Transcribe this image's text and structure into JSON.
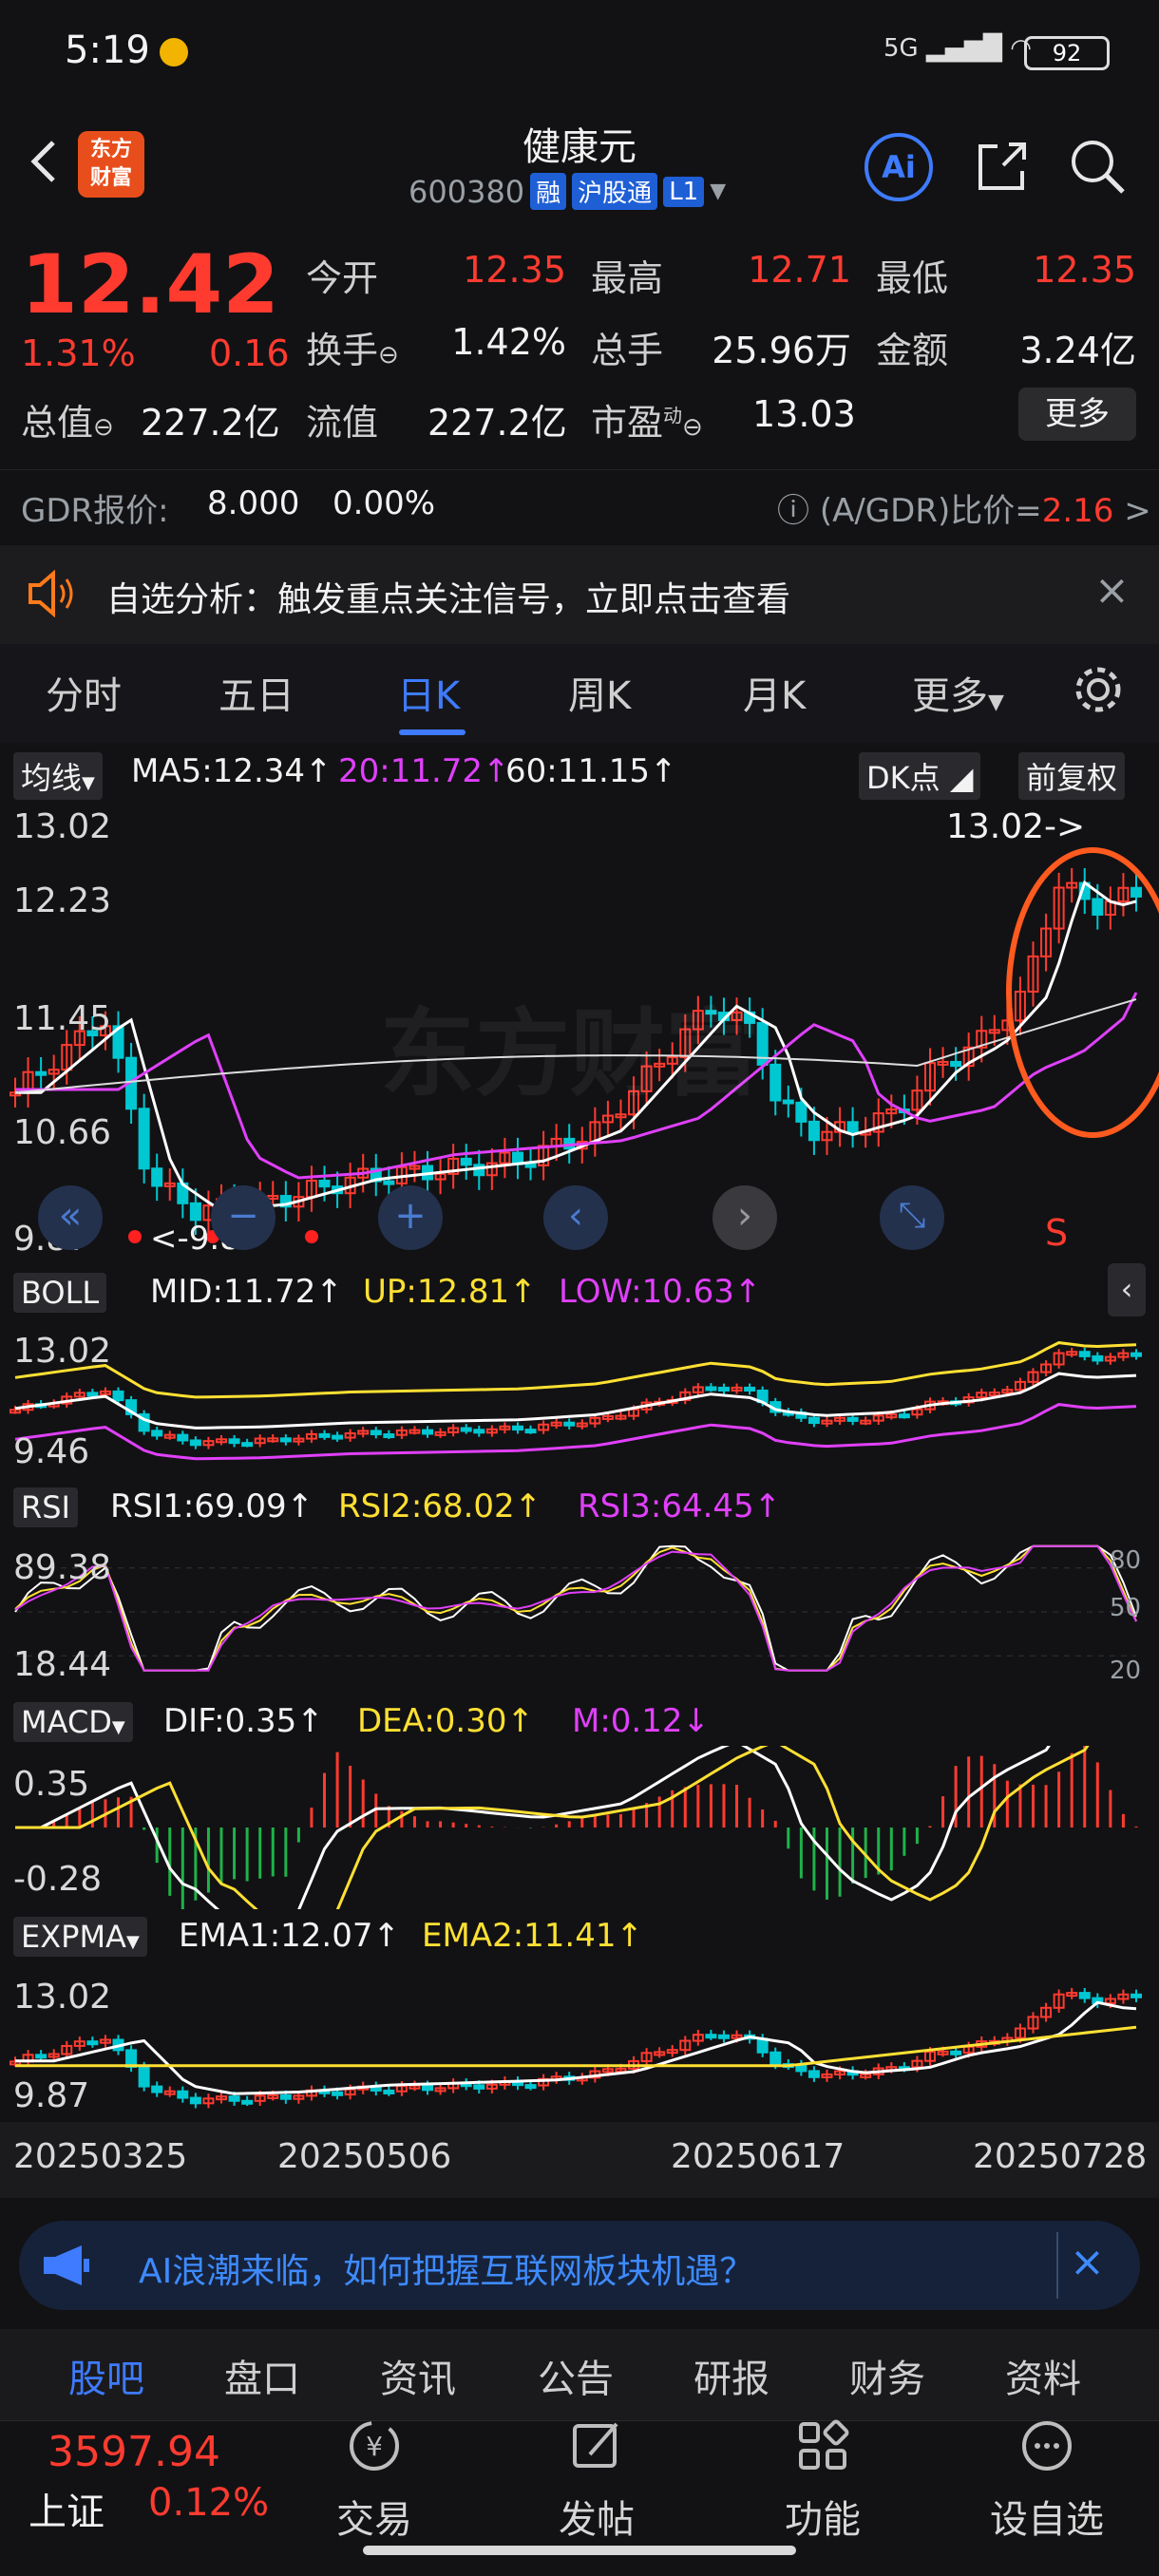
{
  "status_bar": {
    "time": "5:19",
    "signal": "5G",
    "battery": "92"
  },
  "header": {
    "logo_text_line1": "东方",
    "logo_text_line2": "财富",
    "stock_name": "健康元",
    "stock_code": "600380",
    "tags": [
      "融",
      "沪股通",
      "L1"
    ],
    "ai_label": "Ai"
  },
  "quote": {
    "price": "12.42",
    "change_pct": "1.31%",
    "change": "0.16",
    "rows": [
      [
        {
          "label": "今开",
          "value": "12.35",
          "color": "red"
        },
        {
          "label": "最高",
          "value": "12.71",
          "color": "red"
        },
        {
          "label": "最低",
          "value": "12.35",
          "color": "red"
        }
      ],
      [
        {
          "label": "换手",
          "value": "1.42%",
          "color": "white"
        },
        {
          "label": "总手",
          "value": "25.96万",
          "color": "white"
        },
        {
          "label": "金额",
          "value": "3.24亿",
          "color": "white"
        }
      ]
    ],
    "row3": {
      "total_mv_label": "总值",
      "total_mv": "227.2亿",
      "float_mv_label": "流值",
      "float_mv": "227.2亿",
      "pe_label": "市盈",
      "pe_sup": "动",
      "pe": "13.03"
    },
    "more_label": "更多"
  },
  "gdr": {
    "label": "GDR报价:",
    "price": "8.000",
    "pct": "0.00%",
    "ratio_label": "(A/GDR)比价=",
    "ratio": "2.16",
    "arrow": ">"
  },
  "notice": {
    "text": "自选分析：触发重点关注信号，立即点击查看",
    "close": "×"
  },
  "period_tabs": [
    "分时",
    "五日",
    "日K",
    "周K",
    "月K",
    "更多"
  ],
  "active_period": "日K",
  "kline": {
    "ma_btn": "均线",
    "ma5": "MA5:12.34",
    "ma20": "20:11.72",
    "ma60": "60:11.15",
    "dk_btn": "DK点",
    "adj_btn": "前复权",
    "y_labels": [
      "13.02",
      "12.23",
      "11.45",
      "10.66",
      "9.87"
    ],
    "max_marker": "13.02->",
    "min_marker": "<-9.87",
    "sell_marker": "S",
    "watermark": "东方财富"
  },
  "boll": {
    "btn": "BOLL",
    "mid": "MID:11.72",
    "up": "UP:12.81",
    "low": "LOW:10.63",
    "y_top": "13.02",
    "y_bottom": "9.46"
  },
  "rsi": {
    "btn": "RSI",
    "rsi1": "RSI1:69.09",
    "rsi2": "RSI2:68.02",
    "rsi3": "RSI3:64.45",
    "y_top": "89.38",
    "y_bottom": "18.44",
    "levels": [
      "80",
      "50",
      "20"
    ]
  },
  "macd": {
    "btn": "MACD",
    "dif": "DIF:0.35",
    "dea": "DEA:0.30",
    "m": "M:0.12",
    "y_top": "0.35",
    "y_bottom": "-0.28"
  },
  "expma": {
    "btn": "EXPMA",
    "ema1": "EMA1:12.07",
    "ema2": "EMA2:11.41",
    "y_top": "13.02",
    "y_bottom": "9.87"
  },
  "dates": [
    "20250325",
    "20250506",
    "20250617",
    "20250728"
  ],
  "ai_banner": {
    "text": "AI浪潮来临，如何把握互联网板块机遇？",
    "close": "×"
  },
  "bottom_tabs": [
    "股吧",
    "盘口",
    "资讯",
    "公告",
    "研报",
    "财务",
    "资料"
  ],
  "active_bottom_tab": "股吧",
  "index": {
    "value": "3597.94",
    "name": "上证",
    "pct": "0.12%"
  },
  "nav": [
    "交易",
    "发帖",
    "功能",
    "设自选"
  ],
  "colors": {
    "up": "#ff3b30",
    "down": "#00c8d2",
    "accent": "#3e7bff",
    "ma20": "#e040fb",
    "yellow": "#ffe033"
  }
}
